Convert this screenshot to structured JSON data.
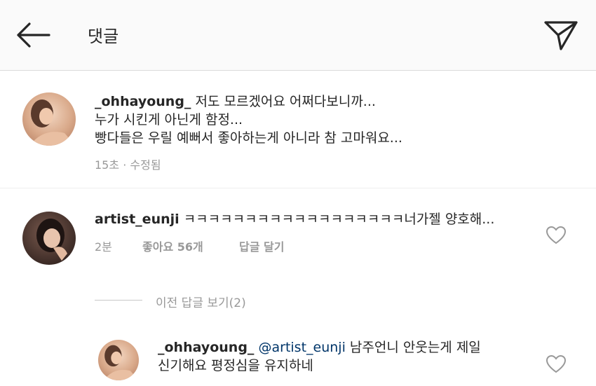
{
  "header": {
    "title": "댓글",
    "back_icon": "arrow-left-icon",
    "send_icon": "paper-plane-icon"
  },
  "comments": [
    {
      "username": "_ohhayoung_",
      "lines": [
        "저도 모르겠어요 어쩌다보니까...",
        "누가 시킨게 아닌게 함정...",
        "빵다들은 우릴 예뻐서 좋아하는게 아니라 참 고마워요..."
      ],
      "time": "15초",
      "separator": "·",
      "edited": "수정됨"
    },
    {
      "username": "artist_eunji",
      "text": "ㅋㅋㅋㅋㅋㅋㅋㅋㅋㅋㅋㅋㅋㅋㅋㅋㅋㅋ너가젤 양호해...",
      "time": "2분",
      "likes": "좋아요 56개",
      "reply": "답글 달기",
      "like_icon": "heart-outline-icon"
    }
  ],
  "view_replies": "이전 답글 보기(2)",
  "reply": {
    "username": "_ohhayoung_",
    "mention": "@artist_eunji",
    "text_line1": "남주언니 안웃는게 제일",
    "text_line2": "신기해요 평정심을 유지하네",
    "like_icon": "heart-outline-icon"
  },
  "colors": {
    "header_bg": "#fafafa",
    "text": "#262626",
    "meta": "#999999",
    "mention": "#003569"
  }
}
